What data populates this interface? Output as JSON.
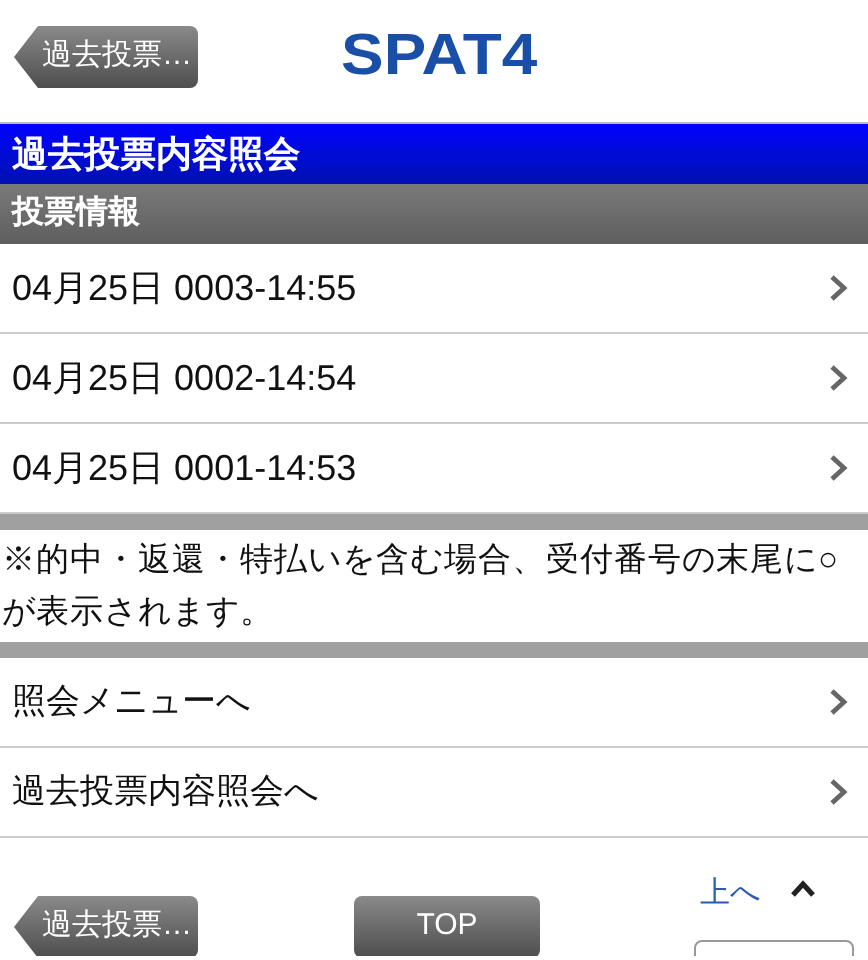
{
  "header": {
    "back_button": "過去投票…",
    "logo": "SPAT4"
  },
  "title_bar": "過去投票内容照会",
  "section_header": "投票情報",
  "vote_rows": [
    {
      "label": "04月25日 0003-14:55"
    },
    {
      "label": "04月25日 0002-14:54"
    },
    {
      "label": "04月25日 0001-14:53"
    }
  ],
  "note": "※的中・返還・特払いを含む場合、受付番号の末尾に○が表示されます。",
  "menu_items": [
    {
      "label": "照会メニューへ"
    },
    {
      "label": "過去投票内容照会へ"
    }
  ],
  "footer": {
    "back_button": "過去投票…",
    "top_button": "TOP",
    "scroll_top_link": "上へ"
  }
}
